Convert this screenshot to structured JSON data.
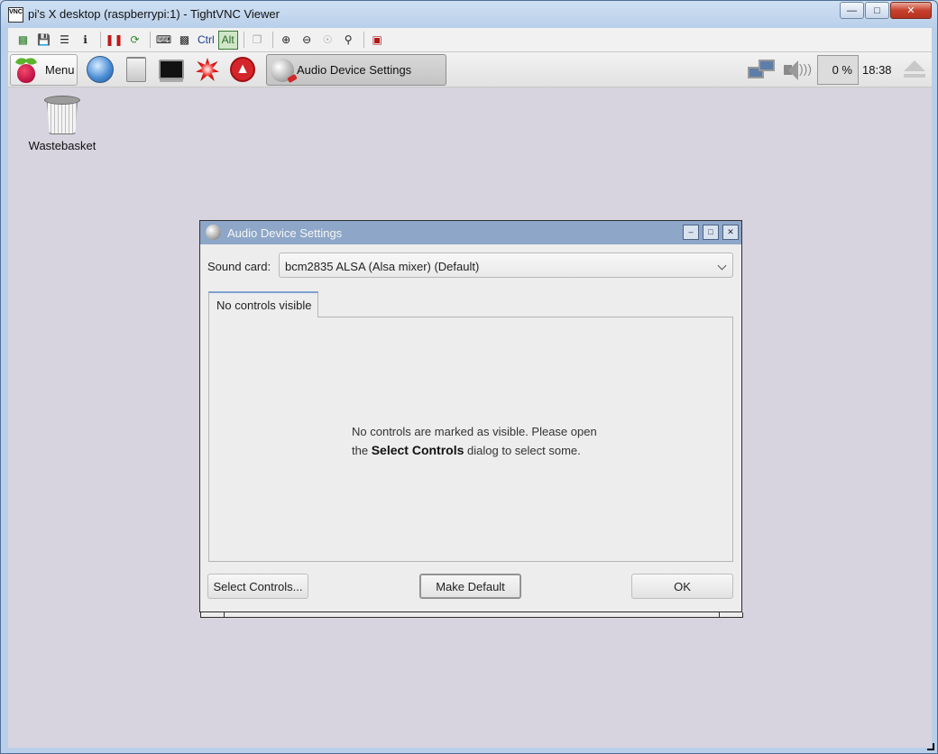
{
  "vnc": {
    "title": "pi's X desktop (raspberrypi:1) - TightVNC Viewer",
    "app_icon_text": "VNC",
    "toolbar": {
      "ctrl_label": "Ctrl",
      "alt_label": "Alt"
    }
  },
  "panel": {
    "menu_label": "Menu",
    "task_label": "Audio Device Settings",
    "cpu_percent": "0 %",
    "clock": "18:38"
  },
  "desktop": {
    "wastebasket_label": "Wastebasket"
  },
  "dialog": {
    "title": "Audio Device Settings",
    "sound_card_label": "Sound card:",
    "sound_card_value": "bcm2835 ALSA (Alsa mixer) (Default)",
    "tab_label": "No controls visible",
    "message_line1": "No controls are marked as visible. Please open",
    "message_the": "the",
    "message_bold": "Select Controls",
    "message_rest": "dialog to select some.",
    "select_controls_button": "Select Controls...",
    "make_default_button": "Make Default",
    "ok_button": "OK"
  },
  "colors": {
    "dialog_titlebar": "#8ea7c8",
    "desktop_bg": "#d7d4df",
    "close_button": "#c7402c"
  }
}
